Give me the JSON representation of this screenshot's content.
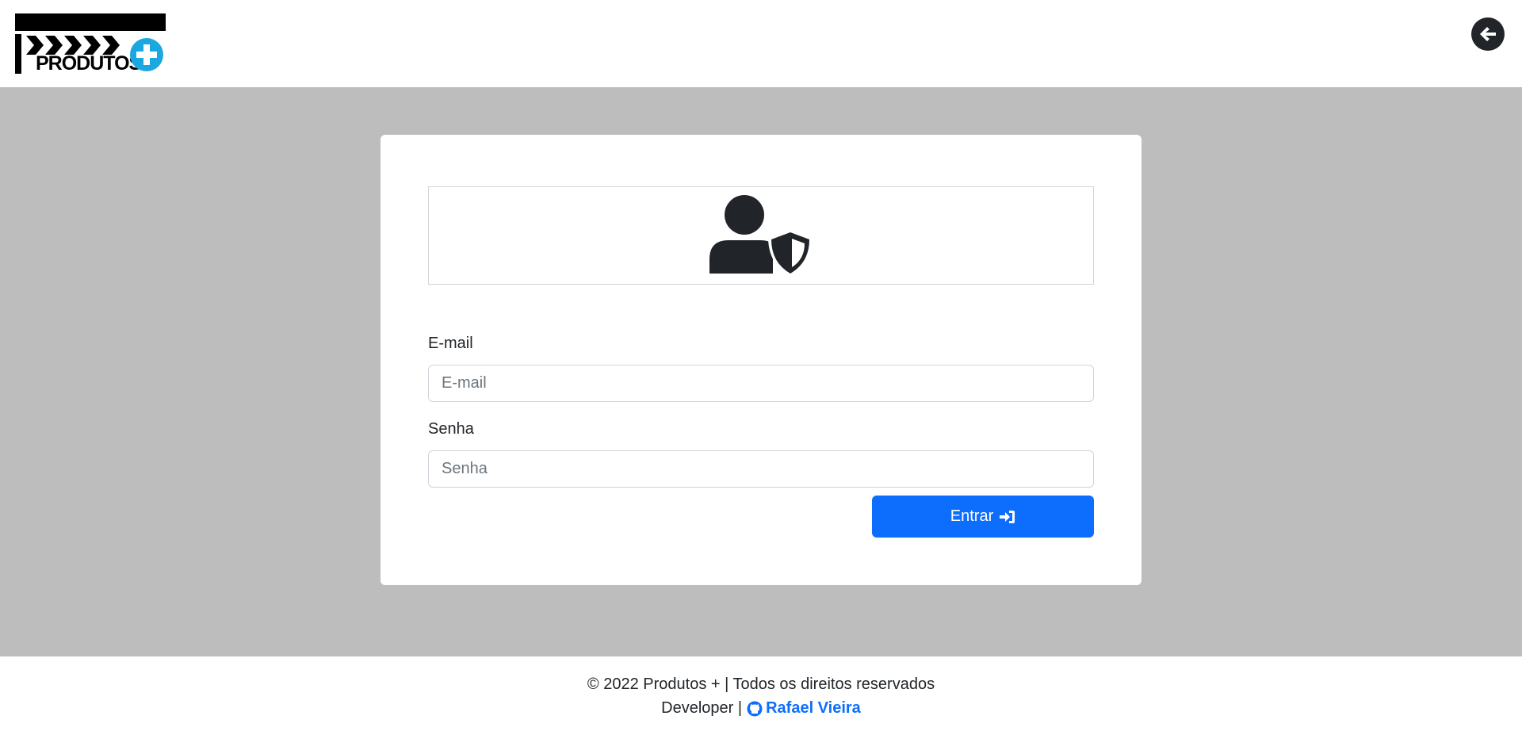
{
  "header": {
    "logo_text": "PRODUTOS",
    "logo_icon": "plus-circle-icon",
    "back_icon": "arrow-left-circle-icon"
  },
  "login": {
    "icon": "user-shield-icon",
    "email_label": "E-mail",
    "email_placeholder": "E-mail",
    "email_value": "",
    "password_label": "Senha",
    "password_placeholder": "Senha",
    "password_value": "",
    "submit_label": "Entrar",
    "submit_icon": "sign-in-icon"
  },
  "footer": {
    "copyright": "© 2022 Produtos + | Todos os direitos reservados",
    "developer_prefix": "Developer |",
    "developer_name": "Rafael Vieira",
    "developer_icon": "github-icon"
  },
  "colors": {
    "primary": "#0d6efd",
    "background": "#bdbdbd",
    "logo_accent": "#1ba8e0",
    "text": "#212529"
  }
}
